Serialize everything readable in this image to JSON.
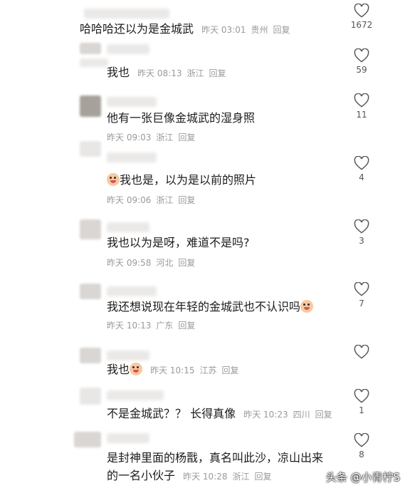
{
  "comments": [
    {
      "text": "哈哈哈还以为是金城武",
      "time": "昨天 03:01",
      "location": "贵州",
      "reply": "回复",
      "likes": "1672"
    },
    {
      "text": "我也",
      "time": "昨天 08:13",
      "location": "浙江",
      "reply": "回复",
      "likes": "59"
    },
    {
      "text": "他有一张巨像金城武的湿身照",
      "time": "昨天 09:03",
      "location": "浙江",
      "reply": "回复",
      "likes": "11"
    },
    {
      "text": "我也是，以为是以前的照片",
      "time": "昨天 09:06",
      "location": "浙江",
      "reply": "回复",
      "likes": "4"
    },
    {
      "text": "我也以为是呀，难道不是吗?",
      "time": "昨天 09:58",
      "location": "河北",
      "reply": "回复",
      "likes": "3"
    },
    {
      "text": "我还想说现在年轻的金城武也不认识吗",
      "time": "昨天 10:13",
      "location": "广东",
      "reply": "回复",
      "likes": "7"
    },
    {
      "text": "我也",
      "time": "昨天 10:15",
      "location": "江苏",
      "reply": "回复",
      "likes": ""
    },
    {
      "text": "不是金城武？？ 长得真像",
      "time": "昨天 10:23",
      "location": "四川",
      "reply": "回复",
      "likes": "1"
    },
    {
      "text_line1": "是封神里面的杨戬，真名叫此沙，凉山出来",
      "text_line2": "的一名小伙子",
      "time": "昨天 10:28",
      "location": "浙江",
      "reply": "回复",
      "likes": "8"
    }
  ],
  "icons": {
    "like": "heart-outline-icon",
    "emoji": "crying-face-emoji-icon"
  },
  "watermark": "头条 @小青柠S"
}
